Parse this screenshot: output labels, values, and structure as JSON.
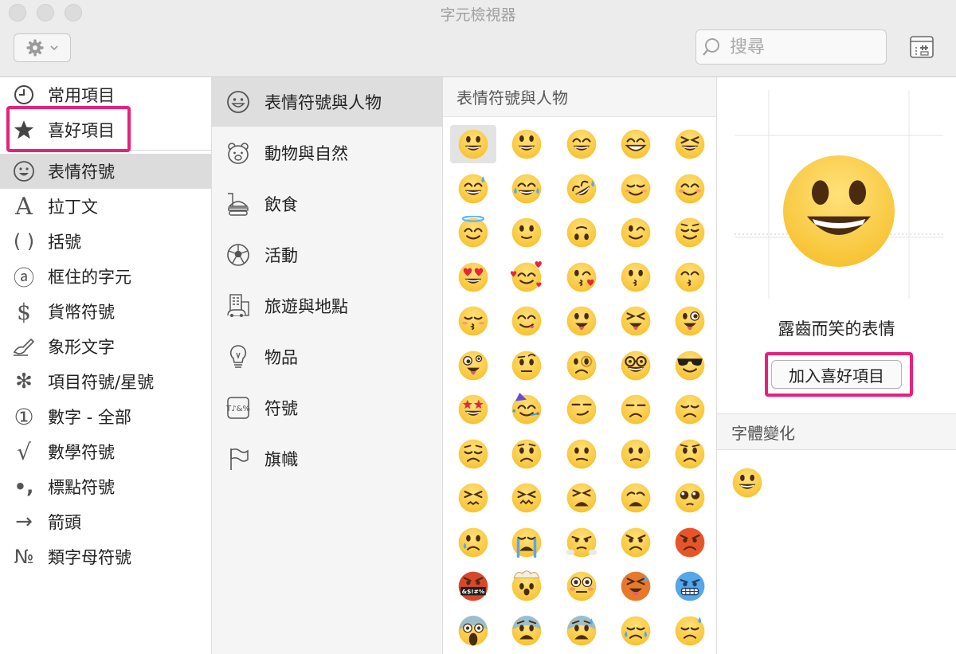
{
  "window": {
    "title": "字元檢視器"
  },
  "toolbar": {
    "search_placeholder": "搜尋"
  },
  "sidebar": {
    "items": [
      {
        "label": "常用項目",
        "icon": "clock-icon"
      },
      {
        "label": "喜好項目",
        "icon": "star-icon"
      },
      {
        "label": "表情符號",
        "icon": "smiley-icon"
      },
      {
        "label": "拉丁文",
        "icon": "latin-a-icon"
      },
      {
        "label": "括號",
        "icon": "parentheses-icon"
      },
      {
        "label": "框住的字元",
        "icon": "circled-a-icon"
      },
      {
        "label": "貨幣符號",
        "icon": "dollar-icon"
      },
      {
        "label": "象形文字",
        "icon": "writing-hand-icon"
      },
      {
        "label": "項目符號/星號",
        "icon": "asterisk-icon"
      },
      {
        "label": "數字 - 全部",
        "icon": "circled-one-icon"
      },
      {
        "label": "數學符號",
        "icon": "square-root-icon"
      },
      {
        "label": "標點符號",
        "icon": "punctuation-icon"
      },
      {
        "label": "箭頭",
        "icon": "arrow-icon"
      },
      {
        "label": "類字母符號",
        "icon": "numero-icon"
      }
    ],
    "selected_index": 2,
    "glyphs": {
      "latin": "A",
      "parens": "( )",
      "circled_a": "ⓐ",
      "dollar": "$",
      "asterisk": "✻",
      "one": "①",
      "sqrt": "√",
      "punct": "•,",
      "arrow": "→",
      "numero": "№"
    }
  },
  "subcategories": {
    "items": [
      {
        "label": "表情符號與人物",
        "icon": "smiley-outline-icon"
      },
      {
        "label": "動物與自然",
        "icon": "bear-icon"
      },
      {
        "label": "飲食",
        "icon": "burger-icon"
      },
      {
        "label": "活動",
        "icon": "soccer-ball-icon"
      },
      {
        "label": "旅遊與地點",
        "icon": "building-icon"
      },
      {
        "label": "物品",
        "icon": "lightbulb-icon"
      },
      {
        "label": "符號",
        "icon": "symbols-icon"
      },
      {
        "label": "旗幟",
        "icon": "flag-icon"
      }
    ],
    "selected_index": 0,
    "symbols_glyph": "T♪&%"
  },
  "grid": {
    "header": "表情符號與人物",
    "columns": 5,
    "emojis": [
      {
        "name": "grinning-face"
      },
      {
        "name": "smiley-face"
      },
      {
        "name": "grin-smile-face"
      },
      {
        "name": "beaming-face"
      },
      {
        "name": "laughing-face"
      },
      {
        "name": "sweat-smile-face"
      },
      {
        "name": "joy-face"
      },
      {
        "name": "rofl-face"
      },
      {
        "name": "relaxed-face"
      },
      {
        "name": "blush-face"
      },
      {
        "name": "halo-face"
      },
      {
        "name": "slight-smile-face"
      },
      {
        "name": "upside-down-face"
      },
      {
        "name": "wink-face"
      },
      {
        "name": "relieved-face"
      },
      {
        "name": "heart-eyes-face"
      },
      {
        "name": "smiling-hearts-face"
      },
      {
        "name": "kissing-heart-face"
      },
      {
        "name": "kissing-face"
      },
      {
        "name": "kissing-smiling-eyes-face"
      },
      {
        "name": "kissing-closed-eyes-face"
      },
      {
        "name": "yum-face"
      },
      {
        "name": "tongue-face"
      },
      {
        "name": "squint-tongue-face"
      },
      {
        "name": "wink-tongue-face"
      },
      {
        "name": "zany-face"
      },
      {
        "name": "raised-eyebrow-face"
      },
      {
        "name": "monocle-face"
      },
      {
        "name": "nerd-face"
      },
      {
        "name": "sunglasses-face"
      },
      {
        "name": "star-struck-face"
      },
      {
        "name": "partying-face"
      },
      {
        "name": "smirk-face"
      },
      {
        "name": "unamused-face"
      },
      {
        "name": "disappointed-face"
      },
      {
        "name": "pensive-face"
      },
      {
        "name": "worried-face"
      },
      {
        "name": "confused-face"
      },
      {
        "name": "slight-frown-face"
      },
      {
        "name": "frowning-face"
      },
      {
        "name": "persevering-face"
      },
      {
        "name": "confounded-face"
      },
      {
        "name": "tired-face"
      },
      {
        "name": "weary-face"
      },
      {
        "name": "pleading-face"
      },
      {
        "name": "crying-face"
      },
      {
        "name": "sobbing-face"
      },
      {
        "name": "steam-face"
      },
      {
        "name": "angry-face"
      },
      {
        "name": "pouting-face"
      },
      {
        "name": "cursing-face"
      },
      {
        "name": "exploding-head-face"
      },
      {
        "name": "flushed-face"
      },
      {
        "name": "hot-face"
      },
      {
        "name": "cold-face"
      },
      {
        "name": "scream-face"
      },
      {
        "name": "fearful-face"
      },
      {
        "name": "anxious-sweat-face"
      },
      {
        "name": "sad-relieved-face"
      },
      {
        "name": "downcast-sweat-face"
      }
    ],
    "selected_index": 0,
    "cursing_text": "&$!#%",
    "colors": {
      "skin": "#f7c232",
      "angry": "#e8542a",
      "cold": "#56a7e6",
      "hot": "#e8792a"
    }
  },
  "detail": {
    "character_name": "露齒而笑的表情",
    "add_favorite_label": "加入喜好項目",
    "font_variations_header": "字體變化",
    "preview_emoji": "grinning-face"
  },
  "annotations": {
    "highlight_color": "#e8217a"
  }
}
